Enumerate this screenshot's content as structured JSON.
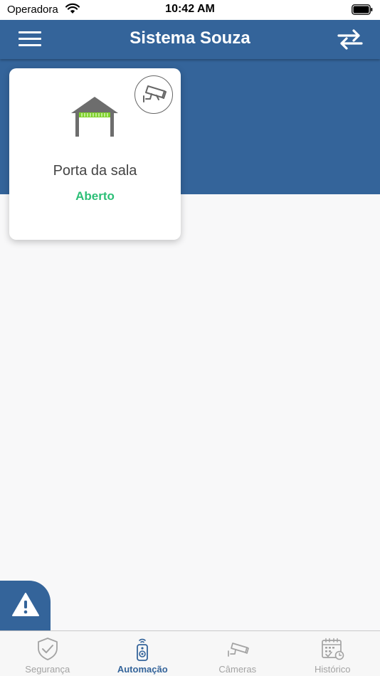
{
  "status_bar": {
    "carrier": "Operadora",
    "time": "10:42 AM"
  },
  "header": {
    "title": "Sistema Souza",
    "menu_icon": "hamburger-icon",
    "switch_icon": "swap-arrows-icon"
  },
  "devices": [
    {
      "name": "Porta da sala",
      "status": "Aberto",
      "icon": "garage-door-icon",
      "badge_icon": "security-camera-icon"
    }
  ],
  "alert_button": {
    "icon": "warning-icon"
  },
  "tabs": [
    {
      "label": "Segurança",
      "icon": "shield-check-icon",
      "active": false
    },
    {
      "label": "Automação",
      "icon": "remote-control-icon",
      "active": true
    },
    {
      "label": "Câmeras",
      "icon": "security-camera-icon",
      "active": false
    },
    {
      "label": "Histórico",
      "icon": "calendar-history-icon",
      "active": false
    }
  ],
  "colors": {
    "primary": "#34649a",
    "status_open": "#2cbf77",
    "tab_inactive": "#a3a3a3",
    "background": "#f8f8f9"
  }
}
